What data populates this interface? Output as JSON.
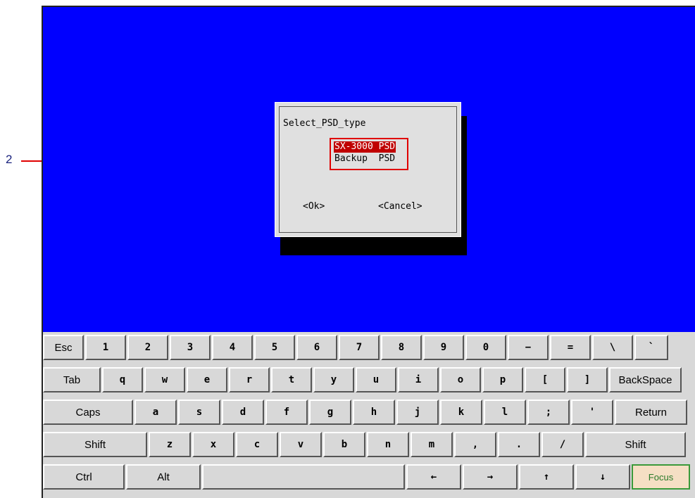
{
  "annotation": {
    "number": "2"
  },
  "dialog": {
    "title": "Select_PSD_type",
    "options": [
      {
        "label": "SX-3000 PSD",
        "selected": true
      },
      {
        "label": "Backup  PSD",
        "selected": false
      }
    ],
    "ok_label": "<Ok>",
    "cancel_label": "<Cancel>"
  },
  "keyboard": {
    "row1": [
      "Esc",
      "1",
      "2",
      "3",
      "4",
      "5",
      "6",
      "7",
      "8",
      "9",
      "0",
      "−",
      "=",
      "\\",
      "`"
    ],
    "row2": [
      "Tab",
      "q",
      "w",
      "e",
      "r",
      "t",
      "y",
      "u",
      "i",
      "o",
      "p",
      "[",
      "]",
      "BackSpace"
    ],
    "row3": [
      "Caps",
      "a",
      "s",
      "d",
      "f",
      "g",
      "h",
      "j",
      "k",
      "l",
      ";",
      "'",
      "Return"
    ],
    "row4": [
      "Shift",
      "z",
      "x",
      "c",
      "v",
      "b",
      "n",
      "m",
      ",",
      ".",
      "/",
      "Shift"
    ],
    "row5": [
      "Ctrl",
      "Alt",
      "",
      "←",
      "→",
      "↑",
      "↓",
      "Focus"
    ]
  },
  "colors": {
    "screen": "#0000ff",
    "selection": "#c00000",
    "annotation": "#e00000",
    "focus_key": "#f5dfc4"
  }
}
